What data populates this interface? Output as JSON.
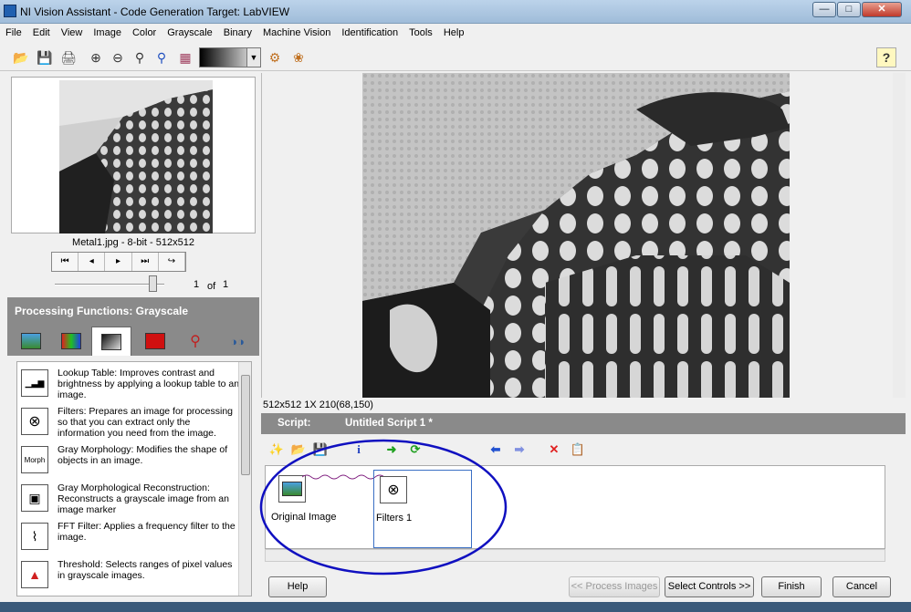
{
  "window": {
    "title": "NI Vision Assistant - Code Generation Target: LabVIEW",
    "min": "—",
    "max": "□",
    "close": "✕"
  },
  "menu": [
    "File",
    "Edit",
    "View",
    "Image",
    "Color",
    "Grayscale",
    "Binary",
    "Machine Vision",
    "Identification",
    "Tools",
    "Help"
  ],
  "toolbar": {
    "help": "?"
  },
  "thumbnail": {
    "caption": "Metal1.jpg - 8-bit - 512x512",
    "page": "1",
    "of_label": "of",
    "total": "1"
  },
  "nav_buttons": [
    "⏮",
    "◂",
    "▸",
    "⏭",
    "↪"
  ],
  "processing": {
    "header": "Processing Functions: Grayscale",
    "tab_icons": [
      "image-icon",
      "color-icon",
      "grayscale-icon",
      "binary-icon",
      "machine-vision-icon",
      "identification-icon"
    ],
    "functions": [
      {
        "icon": "lookup-table-icon",
        "glyph": "▁▃▆",
        "text": "Lookup Table:  Improves contrast and brightness by applying a lookup table to an image."
      },
      {
        "icon": "filters-icon",
        "glyph": "⊗",
        "text": "Filters:  Prepares an image for processing so that you can extract only the information you need from the image."
      },
      {
        "icon": "gray-morphology-icon",
        "glyph": "Morph",
        "text": "Gray Morphology:  Modifies the shape of objects in an image."
      },
      {
        "icon": "gray-morphological-reconstruction-icon",
        "glyph": "▣",
        "text": "Gray Morphological Reconstruction:  Reconstructs a grayscale image from an image marker"
      },
      {
        "icon": "fft-filter-icon",
        "glyph": "⌇",
        "text": "FFT Filter:  Applies a frequency filter to the image."
      },
      {
        "icon": "threshold-icon",
        "glyph": "▲",
        "text": "Threshold:  Selects ranges of pixel values in grayscale images."
      }
    ]
  },
  "viewer": {
    "status_size": "512x512 1X 210",
    "status_coord": "(68,150)"
  },
  "script": {
    "label": "Script:",
    "name": "Untitled Script 1 *",
    "steps": [
      {
        "label": "Original Image",
        "icon": "original-image-icon"
      },
      {
        "label": "Filters 1",
        "icon": "filters-icon"
      }
    ]
  },
  "buttons": {
    "help": "Help",
    "process_images": "<< Process Images",
    "select_controls": "Select Controls >>",
    "finish": "Finish",
    "cancel": "Cancel"
  },
  "colors": {
    "panel_header": "#8a8a8a",
    "annotation_circle": "#1010c0",
    "selection_border": "#3a6fc4"
  }
}
